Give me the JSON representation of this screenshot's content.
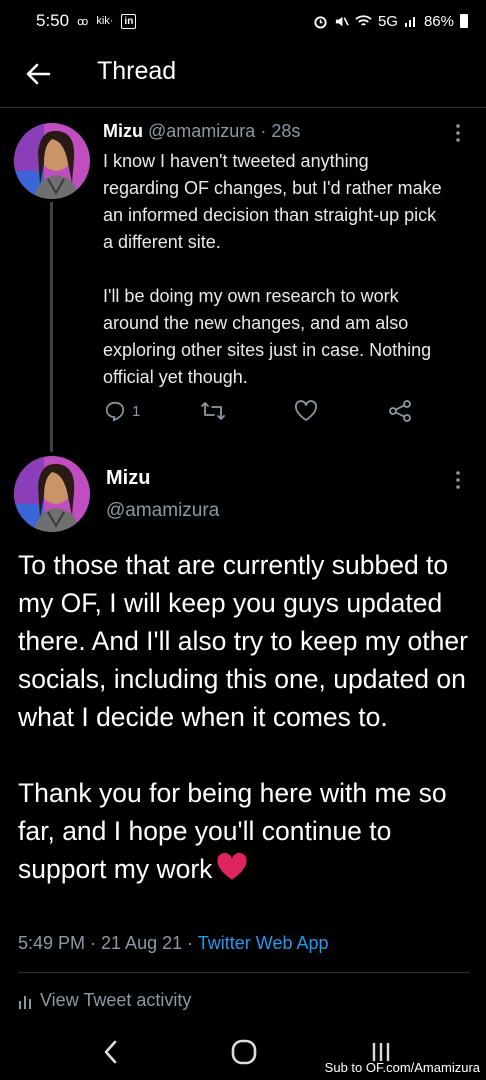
{
  "status_bar": {
    "time": "5:50",
    "network_icons": "ꝏ",
    "kik_label": "kik·",
    "in_label": "in",
    "network_label": "5G",
    "battery_percent": "86%"
  },
  "header": {
    "title": "Thread"
  },
  "tweet1": {
    "name": "Mizu",
    "handle": "@amamizura",
    "time_ago": "· 28s",
    "paragraph1": "I know I haven't tweeted anything regarding OF changes, but I'd rather make an informed decision than straight-up pick a different site.",
    "paragraph2": "I'll be doing my own research to work around the new changes, and am also exploring other sites just in case. Nothing official yet though.",
    "reply_count": "1"
  },
  "tweet2": {
    "name": "Mizu",
    "handle": "@amamizura",
    "paragraph1": "To those that are currently subbed to my OF, I will keep you guys updated there. And I'll also try to keep my other socials, including this one, updated on what I decide when it comes to.",
    "paragraph2": "Thank you for being here with me so far, and I hope you'll continue to support my work",
    "timestamp": "5:49 PM · 21 Aug 21 · ",
    "source": "Twitter Web App"
  },
  "activity": {
    "label": "View Tweet activity"
  },
  "watermark": "Sub to OF.com/Amamizura",
  "colors": {
    "background": "#000000",
    "accent": "#1d9bf0",
    "muted": "#8b98a5",
    "heart": "#e0245e"
  }
}
